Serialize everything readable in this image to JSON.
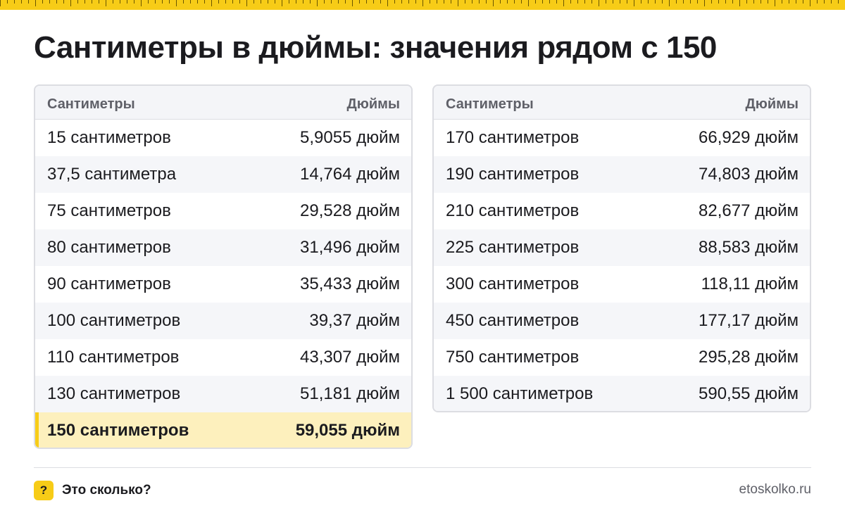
{
  "title": "Сантиметры в дюймы: значения рядом с 150",
  "left_table": {
    "header": {
      "col1": "Сантиметры",
      "col2": "Дюймы"
    },
    "rows": [
      {
        "cm": "15 сантиметров",
        "inch": "5,9055 дюйм"
      },
      {
        "cm": "37,5 сантиметра",
        "inch": "14,764 дюйм"
      },
      {
        "cm": "75 сантиметров",
        "inch": "29,528 дюйм"
      },
      {
        "cm": "80 сантиметров",
        "inch": "31,496 дюйм"
      },
      {
        "cm": "90 сантиметров",
        "inch": "35,433 дюйм"
      },
      {
        "cm": "100 сантиметров",
        "inch": "39,37 дюйм"
      },
      {
        "cm": "110 сантиметров",
        "inch": "43,307 дюйм"
      },
      {
        "cm": "130 сантиметров",
        "inch": "51,181 дюйм"
      },
      {
        "cm": "150 сантиметров",
        "inch": "59,055 дюйм",
        "highlighted": true
      }
    ]
  },
  "right_table": {
    "header": {
      "col1": "Сантиметры",
      "col2": "Дюймы"
    },
    "rows": [
      {
        "cm": "170 сантиметров",
        "inch": "66,929 дюйм"
      },
      {
        "cm": "190 сантиметров",
        "inch": "74,803 дюйм"
      },
      {
        "cm": "210 сантиметров",
        "inch": "82,677 дюйм"
      },
      {
        "cm": "225 сантиметров",
        "inch": "88,583 дюйм"
      },
      {
        "cm": "300 сантиметров",
        "inch": "118,11 дюйм"
      },
      {
        "cm": "450 сантиметров",
        "inch": "177,17 дюйм"
      },
      {
        "cm": "750 сантиметров",
        "inch": "295,28 дюйм"
      },
      {
        "cm": "1 500 сантиметров",
        "inch": "590,55 дюйм"
      }
    ]
  },
  "footer": {
    "brand_icon": "?",
    "brand_name": "Это сколько?",
    "site": "etoskolko.ru"
  },
  "colors": {
    "accent": "#f7cc17",
    "highlight_row": "#fdf0bd",
    "header_bg": "#f4f5f8",
    "border": "#dcdde2"
  }
}
